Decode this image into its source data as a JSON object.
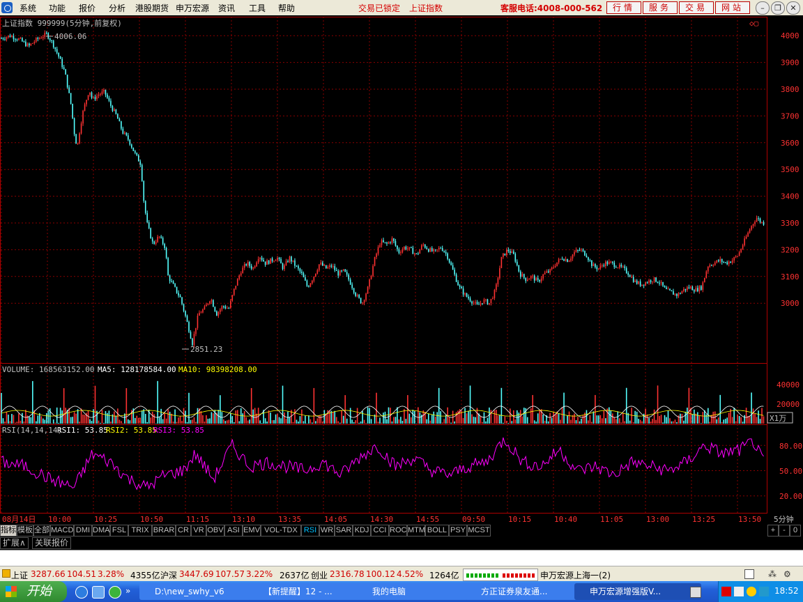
{
  "menu": {
    "items": [
      "系统",
      "功能",
      "报价",
      "分析",
      "港股期货",
      "申万宏源",
      "资讯",
      "工具",
      "帮助"
    ],
    "trade_locked": "交易已锁定",
    "index_name": "上证指数",
    "hotline": "客服电话:4008-000-562",
    "buttons": [
      "行情",
      "服务",
      "交易",
      "网站"
    ]
  },
  "chart": {
    "title": "上证指数 999999(5分钟,前复权)",
    "high_label": "4006.06",
    "low_label": "2851.23",
    "price_axis": [
      "4000",
      "3900",
      "3800",
      "3700",
      "3600",
      "3500",
      "3400",
      "3300",
      "3200",
      "3100",
      "3000"
    ],
    "volume": {
      "label": "VOLUME: 168563152.00",
      "ma5": "MA5: 128178584.00",
      "ma10": "MA10: 98398208.00",
      "axis": [
        "40000",
        "20000"
      ],
      "unit": "X1万"
    },
    "rsi": {
      "label": "RSI(14,14,14)",
      "rsi1": "RSI1: 53.85",
      "rsi2": "RSI2: 53.85",
      "rsi3": "RSI3: 53.85",
      "axis": [
        "80.00",
        "50.00",
        "20.00"
      ]
    },
    "time_axis": [
      "08月14日",
      "10:00",
      "10:25",
      "10:50",
      "11:15",
      "13:10",
      "13:35",
      "14:05",
      "14:30",
      "14:55",
      "09:50",
      "10:15",
      "10:40",
      "11:05",
      "13:00",
      "13:25",
      "13:50"
    ],
    "period": "5分钟"
  },
  "colors": {
    "up": "#ff3232",
    "down": "#54ffff",
    "ma5": "#ffffff",
    "ma10": "#ffff00",
    "rsi": "#ff00ff",
    "grid": "#8b0000"
  },
  "chart_data": {
    "type": "line",
    "price_series_points": [
      [
        0,
        3990
      ],
      [
        3,
        4000
      ],
      [
        6,
        3985
      ],
      [
        9,
        3960
      ],
      [
        11,
        3980
      ],
      [
        13,
        3995
      ],
      [
        15,
        4006
      ],
      [
        17,
        3970
      ],
      [
        19,
        3920
      ],
      [
        21,
        3860
      ],
      [
        23,
        3740
      ],
      [
        24,
        3640
      ],
      [
        25,
        3580
      ],
      [
        26,
        3660
      ],
      [
        27,
        3720
      ],
      [
        28,
        3760
      ],
      [
        29,
        3800
      ],
      [
        30,
        3760
      ],
      [
        32,
        3780
      ],
      [
        34,
        3790
      ],
      [
        36,
        3740
      ],
      [
        38,
        3700
      ],
      [
        40,
        3640
      ],
      [
        42,
        3610
      ],
      [
        44,
        3560
      ],
      [
        46,
        3520
      ],
      [
        47,
        3380
      ],
      [
        48,
        3300
      ],
      [
        50,
        3220
      ],
      [
        52,
        3250
      ],
      [
        54,
        3210
      ],
      [
        55,
        3100
      ],
      [
        57,
        3060
      ],
      [
        59,
        3020
      ],
      [
        61,
        2940
      ],
      [
        63,
        2851
      ],
      [
        65,
        2960
      ],
      [
        67,
        2980
      ],
      [
        69,
        3020
      ],
      [
        71,
        2960
      ],
      [
        73,
        2990
      ],
      [
        75,
        2980
      ],
      [
        77,
        3060
      ],
      [
        79,
        3120
      ],
      [
        81,
        3150
      ],
      [
        83,
        3130
      ],
      [
        85,
        3180
      ],
      [
        87,
        3150
      ],
      [
        89,
        3160
      ],
      [
        91,
        3170
      ],
      [
        93,
        3130
      ],
      [
        95,
        3170
      ],
      [
        97,
        3140
      ],
      [
        99,
        3110
      ],
      [
        101,
        3060
      ],
      [
        103,
        3100
      ],
      [
        105,
        3150
      ],
      [
        107,
        3130
      ],
      [
        109,
        3140
      ],
      [
        111,
        3110
      ],
      [
        113,
        3120
      ],
      [
        115,
        3080
      ],
      [
        117,
        3030
      ],
      [
        119,
        3000
      ],
      [
        121,
        3060
      ],
      [
        123,
        3160
      ],
      [
        125,
        3230
      ],
      [
        127,
        3220
      ],
      [
        129,
        3240
      ],
      [
        131,
        3190
      ],
      [
        133,
        3210
      ],
      [
        135,
        3200
      ],
      [
        137,
        3180
      ],
      [
        139,
        3220
      ],
      [
        141,
        3200
      ],
      [
        143,
        3190
      ],
      [
        145,
        3210
      ],
      [
        147,
        3180
      ],
      [
        149,
        3120
      ],
      [
        151,
        3060
      ],
      [
        153,
        3030
      ],
      [
        155,
        3010
      ],
      [
        157,
        2990
      ],
      [
        159,
        3010
      ],
      [
        161,
        3000
      ],
      [
        163,
        3050
      ],
      [
        165,
        3170
      ],
      [
        167,
        3200
      ],
      [
        169,
        3180
      ],
      [
        171,
        3110
      ],
      [
        173,
        3090
      ],
      [
        175,
        3100
      ],
      [
        177,
        3080
      ],
      [
        179,
        3110
      ],
      [
        181,
        3120
      ],
      [
        183,
        3150
      ],
      [
        185,
        3170
      ],
      [
        187,
        3160
      ],
      [
        189,
        3190
      ],
      [
        191,
        3200
      ],
      [
        193,
        3180
      ],
      [
        195,
        3140
      ],
      [
        197,
        3130
      ],
      [
        199,
        3150
      ],
      [
        201,
        3150
      ],
      [
        203,
        3140
      ],
      [
        205,
        3130
      ],
      [
        207,
        3110
      ],
      [
        209,
        3080
      ],
      [
        211,
        3070
      ],
      [
        213,
        3080
      ],
      [
        215,
        3090
      ],
      [
        217,
        3080
      ],
      [
        219,
        3050
      ],
      [
        221,
        3040
      ],
      [
        223,
        3030
      ],
      [
        225,
        3050
      ],
      [
        227,
        3060
      ],
      [
        229,
        3050
      ],
      [
        231,
        3060
      ],
      [
        233,
        3140
      ],
      [
        235,
        3150
      ],
      [
        237,
        3160
      ],
      [
        239,
        3150
      ],
      [
        241,
        3160
      ],
      [
        243,
        3180
      ],
      [
        245,
        3230
      ],
      [
        247,
        3280
      ],
      [
        249,
        3320
      ],
      [
        251,
        3300
      ],
      [
        252,
        3300
      ]
    ],
    "ylim": [
      2800,
      4050
    ],
    "rsi_points": [
      [
        0,
        60
      ],
      [
        8,
        55
      ],
      [
        16,
        40
      ],
      [
        24,
        30
      ],
      [
        30,
        70
      ],
      [
        36,
        60
      ],
      [
        42,
        40
      ],
      [
        48,
        30
      ],
      [
        54,
        45
      ],
      [
        60,
        50
      ],
      [
        64,
        70
      ],
      [
        70,
        40
      ],
      [
        76,
        80
      ],
      [
        82,
        55
      ],
      [
        88,
        60
      ],
      [
        94,
        55
      ],
      [
        100,
        50
      ],
      [
        106,
        60
      ],
      [
        112,
        45
      ],
      [
        118,
        65
      ],
      [
        124,
        80
      ],
      [
        130,
        55
      ],
      [
        136,
        65
      ],
      [
        142,
        50
      ],
      [
        148,
        45
      ],
      [
        154,
        55
      ],
      [
        160,
        60
      ],
      [
        166,
        88
      ],
      [
        172,
        60
      ],
      [
        178,
        55
      ],
      [
        184,
        75
      ],
      [
        190,
        50
      ],
      [
        196,
        55
      ],
      [
        202,
        45
      ],
      [
        208,
        60
      ],
      [
        214,
        55
      ],
      [
        220,
        50
      ],
      [
        226,
        60
      ],
      [
        232,
        80
      ],
      [
        238,
        70
      ],
      [
        244,
        75
      ],
      [
        248,
        85
      ],
      [
        252,
        55
      ]
    ],
    "rsi_ylim": [
      0,
      100
    ]
  },
  "tabs": [
    "指标",
    "模板",
    "全部",
    "MACD",
    "DMI",
    "DMA",
    "FSL",
    "TRIX",
    "BRAR",
    "CR",
    "VR",
    "OBV",
    "ASI",
    "EMV",
    "VOL-TDX",
    "RSI",
    "WR",
    "SAR",
    "KDJ",
    "CCI",
    "ROC",
    "MTM",
    "BOLL",
    "PSY",
    "MCST"
  ],
  "tab_controls": [
    "+",
    "-",
    "0"
  ],
  "tabs2": [
    "扩展∧",
    "关联报价"
  ],
  "status": {
    "sh_label": "上证",
    "sh_price": "3287.66",
    "sh_chg": "104.51",
    "sh_pct": "3.28%",
    "sh_amt": "4355亿",
    "hs_label": "沪深",
    "hs_price": "3447.69",
    "hs_chg": "107.57",
    "hs_pct": "3.22%",
    "hs_amt": "2637亿",
    "cy_label": "创业",
    "cy_price": "2316.78",
    "cy_chg": "100.12",
    "cy_pct": "4.52%",
    "cy_amt": "1264亿",
    "server": "申万宏源上海一(2)"
  },
  "taskbar": {
    "start": "开始",
    "tasks": [
      "D:\\new_swhy_v6",
      "【新提醒】12 - ...",
      "我的电脑",
      "方正证券泉友通...",
      "申万宏源增强版V..."
    ],
    "clock": "18:52"
  }
}
